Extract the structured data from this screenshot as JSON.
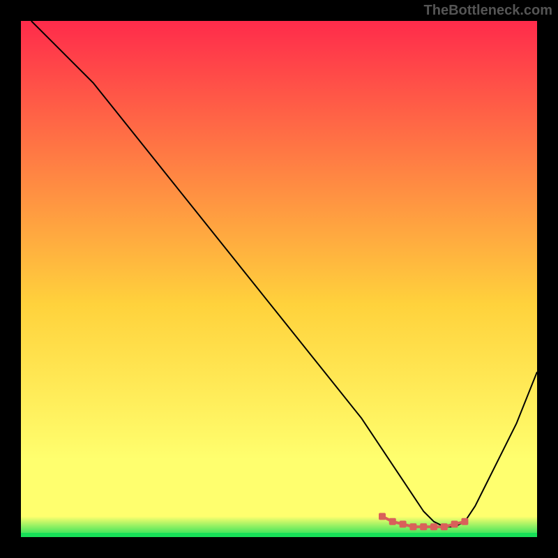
{
  "watermark": "TheBottleneck.com",
  "chart_data": {
    "type": "line",
    "title": "",
    "xlabel": "",
    "ylabel": "",
    "xlim": [
      0,
      100
    ],
    "ylim": [
      0,
      100
    ],
    "grid": false,
    "legend": false,
    "background_gradient": {
      "top": "#ff2b4b",
      "mid_upper": "#ffd23c",
      "mid_lower": "#ffff6e",
      "bottom": "#17e058"
    },
    "series": [
      {
        "name": "curve",
        "type": "line",
        "color": "#000000",
        "stroke_width": 2,
        "x": [
          2,
          6,
          10,
          14,
          18,
          22,
          26,
          30,
          34,
          38,
          42,
          46,
          50,
          54,
          58,
          62,
          66,
          70,
          72,
          74,
          76,
          78,
          80,
          82,
          84,
          86,
          88,
          90,
          92,
          94,
          96,
          98,
          100
        ],
        "y": [
          100,
          96,
          92,
          88,
          83,
          78,
          73,
          68,
          63,
          58,
          53,
          48,
          43,
          38,
          33,
          28,
          23,
          17,
          14,
          11,
          8,
          5,
          3,
          2,
          2,
          3,
          6,
          10,
          14,
          18,
          22,
          27,
          32
        ]
      },
      {
        "name": "highlight-band",
        "type": "line",
        "color": "#d9605a",
        "stroke_width": 8,
        "dotted": true,
        "x": [
          70,
          72,
          74,
          76,
          78,
          80,
          82,
          84,
          86
        ],
        "y": [
          4,
          3,
          2.5,
          2,
          2,
          2,
          2,
          2.5,
          3
        ]
      }
    ]
  }
}
